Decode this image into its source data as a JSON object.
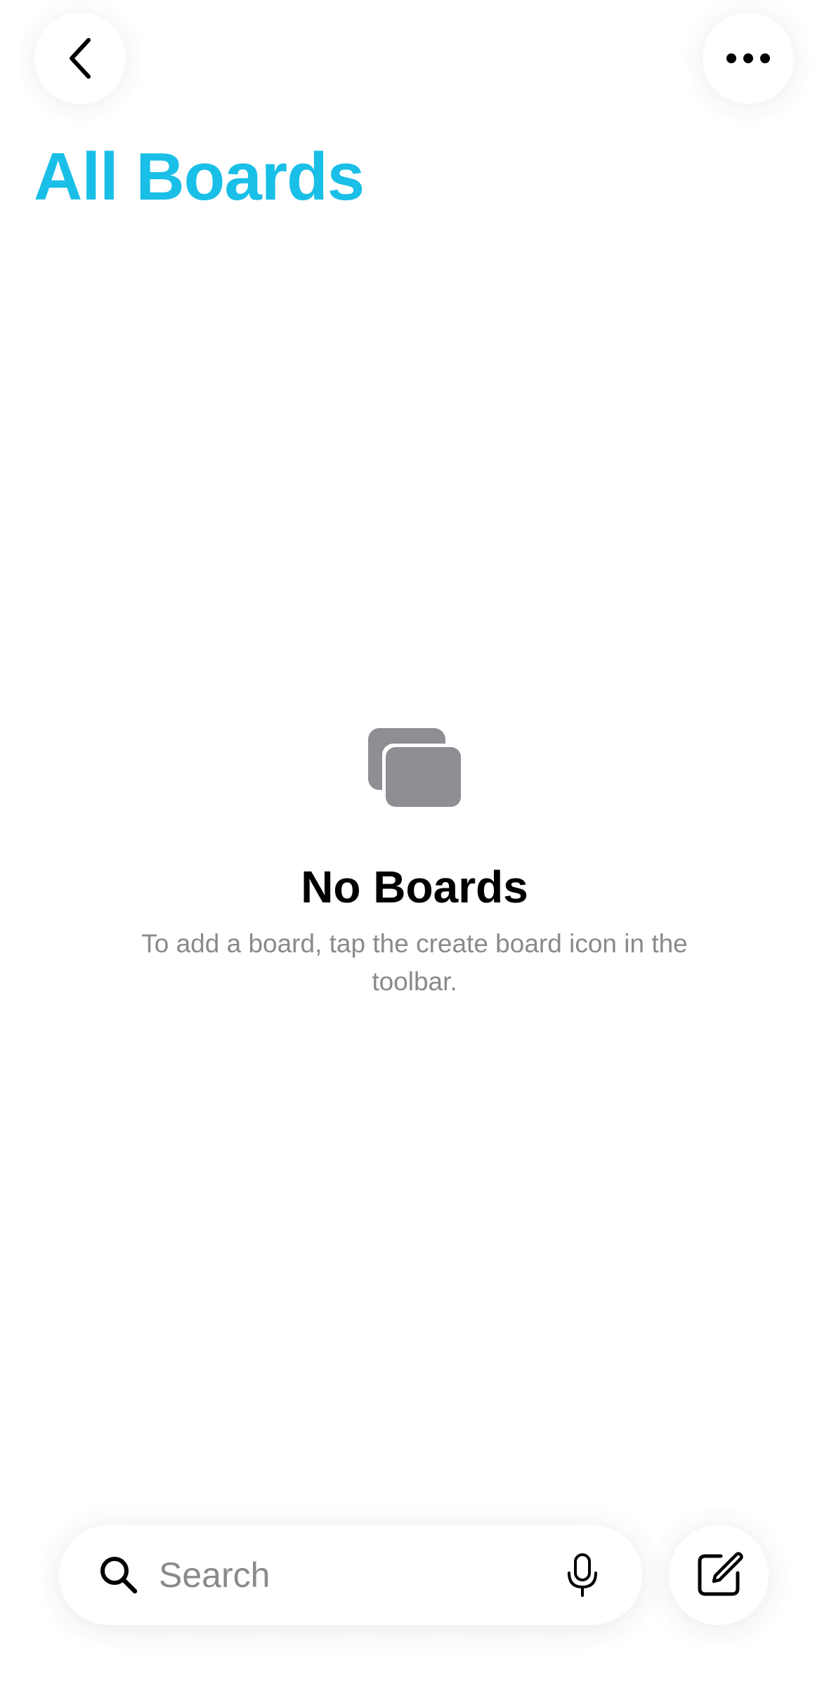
{
  "header": {
    "back_icon": "chevron-left-icon",
    "more_icon": "ellipsis-icon",
    "title": "All Boards",
    "title_color": "#19bfe7"
  },
  "empty_state": {
    "icon": "stacked-boards-icon",
    "icon_color": "#8e8e93",
    "title": "No Boards",
    "message": "To add a board, tap the create board icon in the toolbar."
  },
  "toolbar": {
    "search": {
      "icon": "search-icon",
      "placeholder": "Search",
      "value": "",
      "mic_icon": "microphone-icon"
    },
    "compose_icon": "compose-board-icon"
  }
}
